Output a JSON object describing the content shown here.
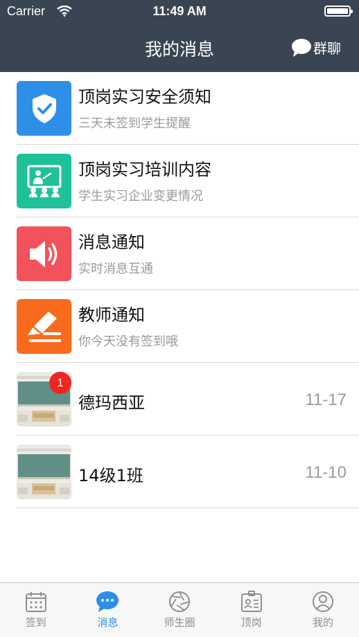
{
  "status_bar": {
    "carrier": "Carrier",
    "time": "11:49 AM"
  },
  "nav": {
    "title": "我的消息",
    "group_chat_label": "群聊"
  },
  "messages": [
    {
      "title": "顶岗实习安全须知",
      "subtitle": "三天未签到学生提醒",
      "icon": "shield-check-icon",
      "color": "#2e8fe8"
    },
    {
      "title": "顶岗实习培训内容",
      "subtitle": "学生实习企业变更情况",
      "icon": "classroom-icon",
      "color": "#1fc19a"
    },
    {
      "title": "消息通知",
      "subtitle": "实时消息互通",
      "icon": "speaker-icon",
      "color": "#f2525a"
    },
    {
      "title": "教师通知",
      "subtitle": "你今天没有签到哦",
      "icon": "pen-icon",
      "color": "#f86b1d"
    },
    {
      "title": "德玛西亚",
      "date": "11-17",
      "badge": "1",
      "icon": "classroom-photo"
    },
    {
      "title": "14级1班",
      "date": "11-10",
      "icon": "classroom-photo"
    }
  ],
  "tabs": [
    {
      "label": "签到",
      "icon": "calendar-icon",
      "active": false
    },
    {
      "label": "消息",
      "icon": "chat-bubble-icon",
      "active": true
    },
    {
      "label": "师生圈",
      "icon": "aperture-icon",
      "active": false
    },
    {
      "label": "顶岗",
      "icon": "id-card-icon",
      "active": false
    },
    {
      "label": "我的",
      "icon": "user-icon",
      "active": false
    }
  ],
  "colors": {
    "nav_bg": "#3a4553",
    "accent": "#2b8fe8",
    "badge": "#f22420"
  }
}
